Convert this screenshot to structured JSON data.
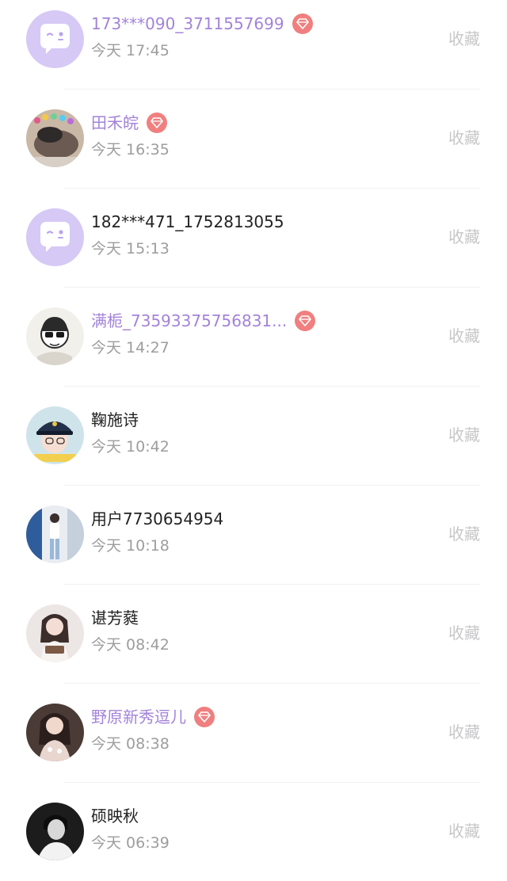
{
  "colors": {
    "vip_name": "#a383d9",
    "normal_name": "#222222",
    "time": "#9d9d9d",
    "favorite_action": "#c7c7c9",
    "vip_badge": "#f07f7f"
  },
  "rows": [
    {
      "name": "173***090_3711557699",
      "vip": true,
      "time": "今天 17:45",
      "action": "收藏",
      "avatar": "default-chat-bubble-avatar"
    },
    {
      "name": "田禾皖",
      "vip": true,
      "time": "今天 16:35",
      "action": "收藏",
      "avatar": "pig-photo-avatar"
    },
    {
      "name": "182***471_1752813055",
      "vip": false,
      "time": "今天 15:13",
      "action": "收藏",
      "avatar": "default-chat-bubble-avatar"
    },
    {
      "name": "满栀_73593375756831...",
      "vip": true,
      "time": "今天 14:27",
      "action": "收藏",
      "avatar": "cartoon-sketch-avatar"
    },
    {
      "name": "鞠施诗",
      "vip": false,
      "time": "今天 10:42",
      "action": "收藏",
      "avatar": "police-cap-avatar"
    },
    {
      "name": "用户7730654954",
      "vip": false,
      "time": "今天 10:18",
      "action": "收藏",
      "avatar": "fullbody-photo-avatar"
    },
    {
      "name": "谌芳蕤",
      "vip": false,
      "time": "今天 08:42",
      "action": "收藏",
      "avatar": "girl-reading-avatar"
    },
    {
      "name": "野原新秀逗儿",
      "vip": true,
      "time": "今天 08:38",
      "action": "收藏",
      "avatar": "girl-dress-avatar"
    },
    {
      "name": "硕映秋",
      "vip": false,
      "time": "今天 06:39",
      "action": "收藏",
      "avatar": "bw-portrait-avatar"
    }
  ]
}
